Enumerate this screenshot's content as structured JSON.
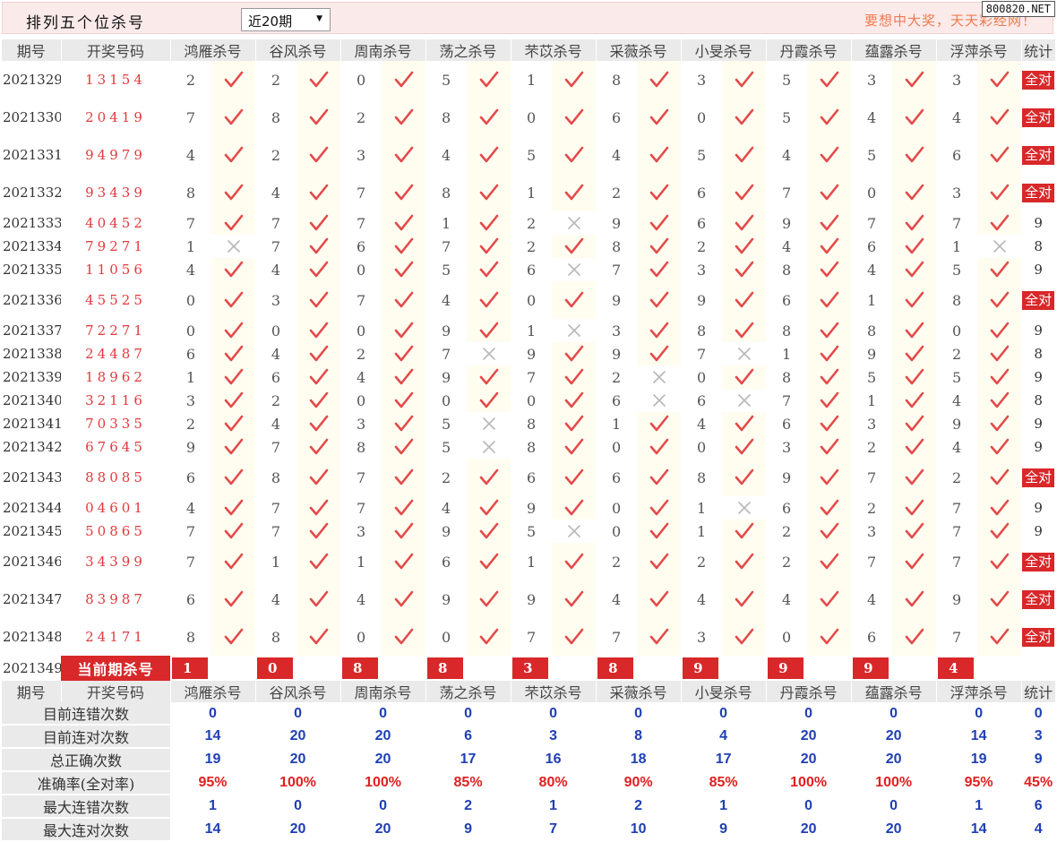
{
  "page": {
    "title": "排列五个位杀号",
    "period_select": "近20期",
    "slogan": "要想中大奖，天天彩经网！",
    "site_badge": "800820.NET"
  },
  "header": {
    "issue": "期号",
    "draw": "开奖号码",
    "experts": [
      "鸿雁杀号",
      "谷风杀号",
      "周南杀号",
      "荡之杀号",
      "芣苡杀号",
      "采薇杀号",
      "小旻杀号",
      "丹霞杀号",
      "蕴露杀号",
      "浮萍杀号"
    ],
    "stat": "统计"
  },
  "rows": [
    {
      "issue": "2021329",
      "draw": "13154",
      "kills": [
        2,
        2,
        0,
        5,
        1,
        8,
        3,
        5,
        3,
        3
      ],
      "ok": [
        1,
        1,
        1,
        1,
        1,
        1,
        1,
        1,
        1,
        1
      ],
      "stat": "全对"
    },
    {
      "issue": "2021330",
      "draw": "20419",
      "kills": [
        7,
        8,
        2,
        8,
        0,
        6,
        0,
        5,
        4,
        4
      ],
      "ok": [
        1,
        1,
        1,
        1,
        1,
        1,
        1,
        1,
        1,
        1
      ],
      "stat": "全对"
    },
    {
      "issue": "2021331",
      "draw": "94979",
      "kills": [
        4,
        2,
        3,
        4,
        5,
        4,
        5,
        4,
        5,
        6
      ],
      "ok": [
        1,
        1,
        1,
        1,
        1,
        1,
        1,
        1,
        1,
        1
      ],
      "stat": "全对"
    },
    {
      "issue": "2021332",
      "draw": "93439",
      "kills": [
        8,
        4,
        7,
        8,
        1,
        2,
        6,
        7,
        0,
        3
      ],
      "ok": [
        1,
        1,
        1,
        1,
        1,
        1,
        1,
        1,
        1,
        1
      ],
      "stat": "全对"
    },
    {
      "issue": "2021333",
      "draw": "40452",
      "kills": [
        7,
        7,
        7,
        1,
        2,
        9,
        6,
        9,
        7,
        7
      ],
      "ok": [
        1,
        1,
        1,
        1,
        0,
        1,
        1,
        1,
        1,
        1
      ],
      "stat": "9"
    },
    {
      "issue": "2021334",
      "draw": "79271",
      "kills": [
        1,
        7,
        6,
        7,
        2,
        8,
        2,
        4,
        6,
        1
      ],
      "ok": [
        0,
        1,
        1,
        1,
        1,
        1,
        1,
        1,
        1,
        0
      ],
      "stat": "8"
    },
    {
      "issue": "2021335",
      "draw": "11056",
      "kills": [
        4,
        4,
        0,
        5,
        6,
        7,
        3,
        8,
        4,
        5
      ],
      "ok": [
        1,
        1,
        1,
        1,
        0,
        1,
        1,
        1,
        1,
        1
      ],
      "stat": "9"
    },
    {
      "issue": "2021336",
      "draw": "45525",
      "kills": [
        0,
        3,
        7,
        4,
        0,
        9,
        9,
        6,
        1,
        8
      ],
      "ok": [
        1,
        1,
        1,
        1,
        1,
        1,
        1,
        1,
        1,
        1
      ],
      "stat": "全对"
    },
    {
      "issue": "2021337",
      "draw": "72271",
      "kills": [
        0,
        0,
        0,
        9,
        1,
        3,
        8,
        8,
        8,
        0
      ],
      "ok": [
        1,
        1,
        1,
        1,
        0,
        1,
        1,
        1,
        1,
        1
      ],
      "stat": "9"
    },
    {
      "issue": "2021338",
      "draw": "24487",
      "kills": [
        6,
        4,
        2,
        7,
        9,
        9,
        7,
        1,
        9,
        2
      ],
      "ok": [
        1,
        1,
        1,
        0,
        1,
        1,
        0,
        1,
        1,
        1
      ],
      "stat": "8"
    },
    {
      "issue": "2021339",
      "draw": "18962",
      "kills": [
        1,
        6,
        4,
        9,
        7,
        2,
        0,
        8,
        5,
        5
      ],
      "ok": [
        1,
        1,
        1,
        1,
        1,
        0,
        1,
        1,
        1,
        1
      ],
      "stat": "9"
    },
    {
      "issue": "2021340",
      "draw": "32116",
      "kills": [
        3,
        2,
        0,
        0,
        0,
        6,
        6,
        7,
        1,
        4
      ],
      "ok": [
        1,
        1,
        1,
        1,
        1,
        0,
        0,
        1,
        1,
        1
      ],
      "stat": "8"
    },
    {
      "issue": "2021341",
      "draw": "70335",
      "kills": [
        2,
        4,
        3,
        5,
        8,
        1,
        4,
        6,
        3,
        9
      ],
      "ok": [
        1,
        1,
        1,
        0,
        1,
        1,
        1,
        1,
        1,
        1
      ],
      "stat": "9"
    },
    {
      "issue": "2021342",
      "draw": "67645",
      "kills": [
        9,
        7,
        8,
        5,
        8,
        0,
        0,
        3,
        2,
        4
      ],
      "ok": [
        1,
        1,
        1,
        0,
        1,
        1,
        1,
        1,
        1,
        1
      ],
      "stat": "9"
    },
    {
      "issue": "2021343",
      "draw": "88085",
      "kills": [
        6,
        8,
        7,
        2,
        6,
        6,
        8,
        9,
        7,
        2
      ],
      "ok": [
        1,
        1,
        1,
        1,
        1,
        1,
        1,
        1,
        1,
        1
      ],
      "stat": "全对"
    },
    {
      "issue": "2021344",
      "draw": "04601",
      "kills": [
        4,
        7,
        7,
        4,
        9,
        0,
        1,
        6,
        2,
        7
      ],
      "ok": [
        1,
        1,
        1,
        1,
        1,
        1,
        0,
        1,
        1,
        1
      ],
      "stat": "9"
    },
    {
      "issue": "2021345",
      "draw": "50865",
      "kills": [
        7,
        7,
        3,
        9,
        5,
        0,
        1,
        2,
        3,
        7
      ],
      "ok": [
        1,
        1,
        1,
        1,
        0,
        1,
        1,
        1,
        1,
        1
      ],
      "stat": "9"
    },
    {
      "issue": "2021346",
      "draw": "34399",
      "kills": [
        7,
        1,
        1,
        6,
        1,
        2,
        2,
        2,
        7,
        7
      ],
      "ok": [
        1,
        1,
        1,
        1,
        1,
        1,
        1,
        1,
        1,
        1
      ],
      "stat": "全对"
    },
    {
      "issue": "2021347",
      "draw": "83987",
      "kills": [
        6,
        4,
        4,
        9,
        9,
        4,
        4,
        4,
        4,
        9
      ],
      "ok": [
        1,
        1,
        1,
        1,
        1,
        1,
        1,
        1,
        1,
        1
      ],
      "stat": "全对"
    },
    {
      "issue": "2021348",
      "draw": "24171",
      "kills": [
        8,
        8,
        0,
        0,
        7,
        7,
        3,
        0,
        6,
        7
      ],
      "ok": [
        1,
        1,
        1,
        1,
        1,
        1,
        1,
        1,
        1,
        1
      ],
      "stat": "全对"
    }
  ],
  "current": {
    "issue": "2021349",
    "label": "当前期杀号",
    "kills": [
      "1",
      "0",
      "8",
      "8",
      "3",
      "8",
      "9",
      "9",
      "9",
      "4"
    ]
  },
  "summary": [
    {
      "label": "目前连错次数",
      "values": [
        "0",
        "0",
        "0",
        "0",
        "0",
        "0",
        "0",
        "0",
        "0",
        "0"
      ],
      "stat": "0"
    },
    {
      "label": "目前连对次数",
      "values": [
        "14",
        "20",
        "20",
        "6",
        "3",
        "8",
        "4",
        "20",
        "20",
        "14"
      ],
      "stat": "3"
    },
    {
      "label": "总正确次数",
      "values": [
        "19",
        "20",
        "20",
        "17",
        "16",
        "18",
        "17",
        "20",
        "20",
        "19"
      ],
      "stat": "9"
    },
    {
      "label": "准确率(全对率)",
      "values": [
        "95%",
        "100%",
        "100%",
        "85%",
        "80%",
        "90%",
        "85%",
        "100%",
        "100%",
        "95%"
      ],
      "stat": "45%",
      "pct": true
    },
    {
      "label": "最大连错次数",
      "values": [
        "1",
        "0",
        "0",
        "2",
        "1",
        "2",
        "1",
        "0",
        "0",
        "1"
      ],
      "stat": "6"
    },
    {
      "label": "最大连对次数",
      "values": [
        "14",
        "20",
        "20",
        "9",
        "7",
        "10",
        "9",
        "20",
        "20",
        "14"
      ],
      "stat": "4"
    }
  ]
}
